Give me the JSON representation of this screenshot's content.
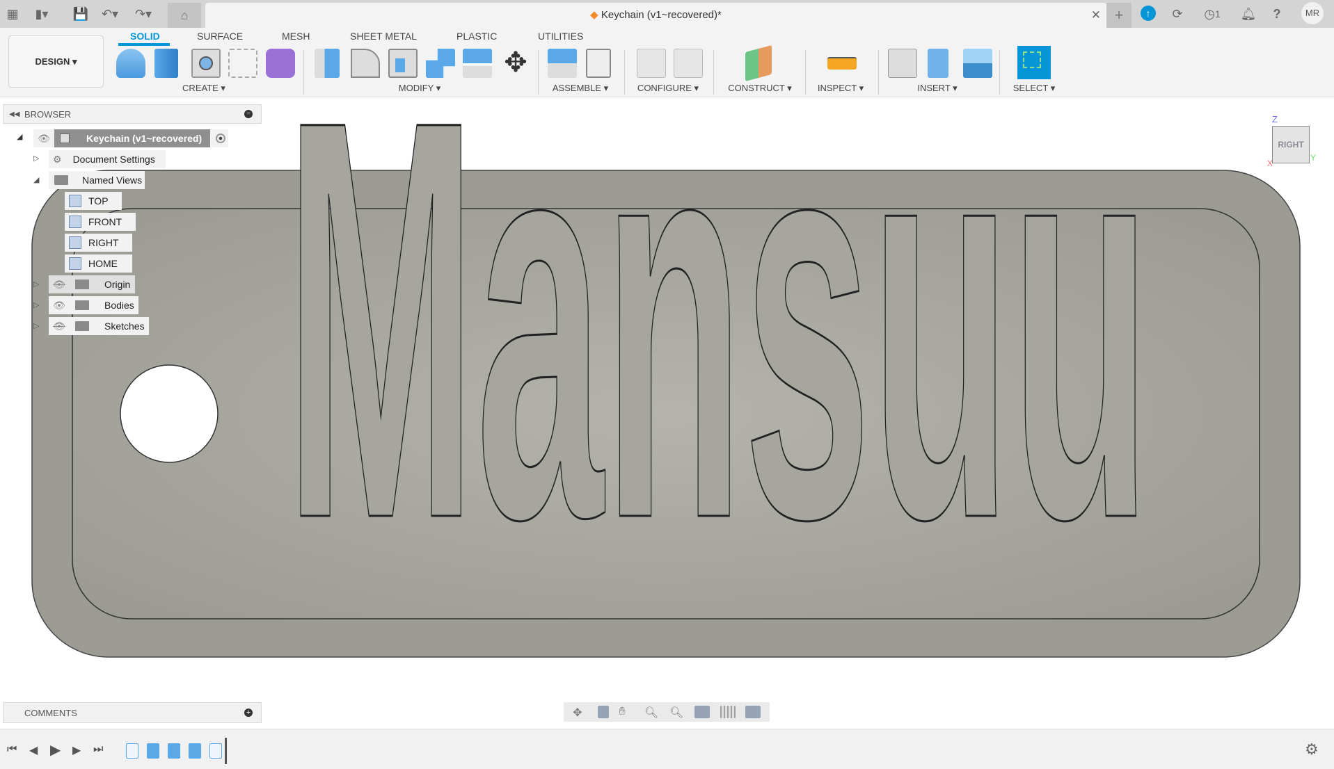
{
  "titlebar": {
    "document_title": "Keychain (v1~recovered)*",
    "notification_count": "1",
    "user_initials": "MR"
  },
  "toolbar": {
    "workspace": "DESIGN ▾",
    "tabs": [
      {
        "label": "SOLID",
        "active": true
      },
      {
        "label": "SURFACE"
      },
      {
        "label": "MESH"
      },
      {
        "label": "SHEET METAL"
      },
      {
        "label": "PLASTIC"
      },
      {
        "label": "UTILITIES"
      }
    ],
    "groups": [
      "CREATE ▾",
      "MODIFY ▾",
      "ASSEMBLE ▾",
      "CONFIGURE ▾",
      "CONSTRUCT ▾",
      "INSPECT ▾",
      "INSERT ▾",
      "SELECT ▾"
    ]
  },
  "browser": {
    "title": "BROWSER",
    "root": "Keychain (v1~recovered)",
    "items": [
      {
        "label": "Document Settings"
      },
      {
        "label": "Named Views"
      },
      {
        "label": "TOP"
      },
      {
        "label": "FRONT"
      },
      {
        "label": "RIGHT"
      },
      {
        "label": "HOME"
      },
      {
        "label": "Origin",
        "visible": false
      },
      {
        "label": "Bodies",
        "visible": true
      },
      {
        "label": "Sketches",
        "visible": false
      }
    ]
  },
  "viewport": {
    "model_text": "Mansuu",
    "viewcube_face": "RIGHT",
    "axes": {
      "x": "X",
      "y": "Y",
      "z": "Z"
    },
    "model_color": "#a8a8a0"
  },
  "comments": {
    "title": "COMMENTS"
  },
  "colors": {
    "accent": "#0696d7"
  }
}
